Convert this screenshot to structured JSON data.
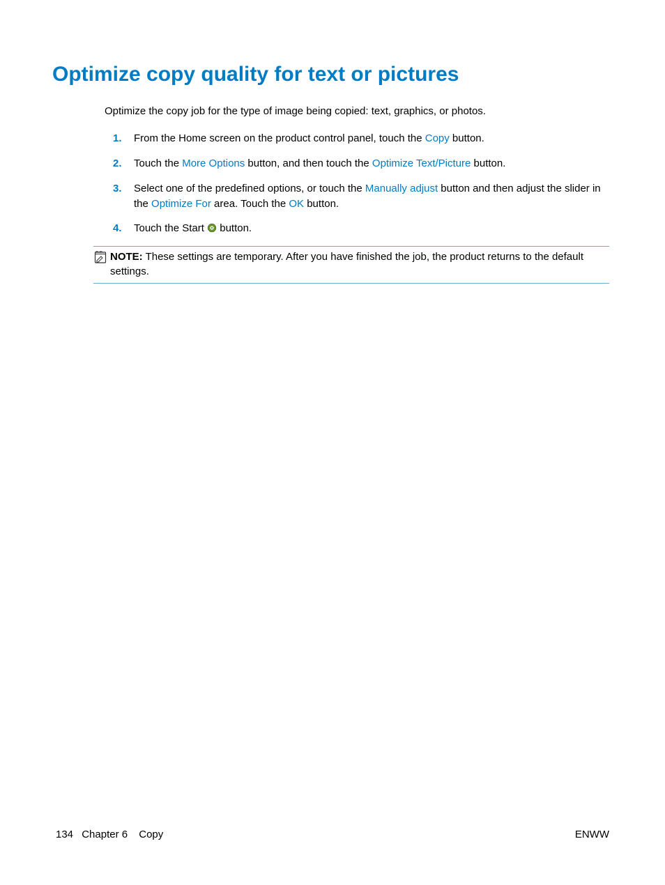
{
  "heading": "Optimize copy quality for text or pictures",
  "intro": "Optimize the copy job for the type of image being copied: text, graphics, or photos.",
  "steps": [
    {
      "num": "1.",
      "parts": [
        "From the Home screen on the product control panel, touch the ",
        {
          "ui": "Copy"
        },
        " button."
      ]
    },
    {
      "num": "2.",
      "parts": [
        "Touch the ",
        {
          "ui": "More Options"
        },
        " button, and then touch the ",
        {
          "ui": "Optimize Text/Picture"
        },
        " button."
      ]
    },
    {
      "num": "3.",
      "parts": [
        "Select one of the predefined options, or touch the ",
        {
          "ui": "Manually adjust"
        },
        " button and then adjust the slider in the ",
        {
          "ui": "Optimize For"
        },
        " area. Touch the ",
        {
          "ui": "OK"
        },
        " button."
      ]
    },
    {
      "num": "4.",
      "parts": [
        "Touch the Start ",
        {
          "icon": "start"
        },
        " button."
      ]
    }
  ],
  "note": {
    "label": "NOTE:",
    "text": "These settings are temporary. After you have finished the job, the product returns to the default settings."
  },
  "footer": {
    "page_number": "134",
    "chapter_label": "Chapter 6",
    "chapter_name": "Copy",
    "right": "ENWW"
  }
}
